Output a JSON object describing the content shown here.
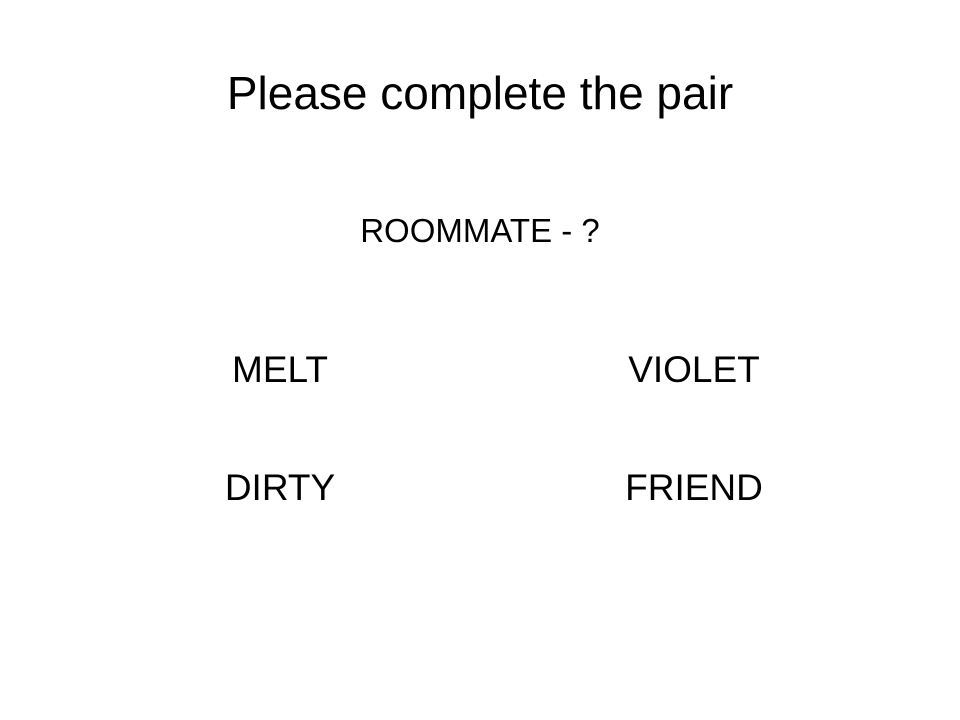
{
  "slide": {
    "title": "Please complete the pair",
    "prompt": "ROOMMATE - ?",
    "options": [
      {
        "label": "MELT"
      },
      {
        "label": "VIOLET"
      },
      {
        "label": "DIRTY"
      },
      {
        "label": "FRIEND"
      }
    ]
  },
  "colors": {
    "background": "#ffffff",
    "text": "#000000"
  }
}
